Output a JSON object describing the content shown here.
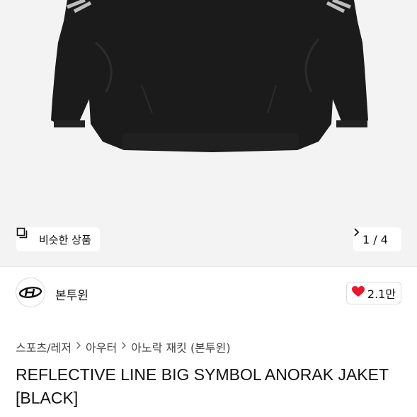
{
  "product": {
    "similar_label": "비슷한 상품",
    "image_counter": "1 / 4"
  },
  "brand": {
    "name": "본투윈",
    "likes": "2.1만"
  },
  "breadcrumb": [
    "스포츠/레저",
    "아우터",
    "아노락 재킷 (본투윈)"
  ],
  "title": "REFLECTIVE LINE BIG SYMBOL ANORAK JAKET [BLACK]",
  "colors": {
    "heart": "#e8192c",
    "image_bg": "#f3f3f3",
    "jacket": "#1b1b1b"
  },
  "icons": {
    "similar": "similar-items-icon",
    "next": "chevron-right-icon",
    "like": "heart-icon"
  }
}
